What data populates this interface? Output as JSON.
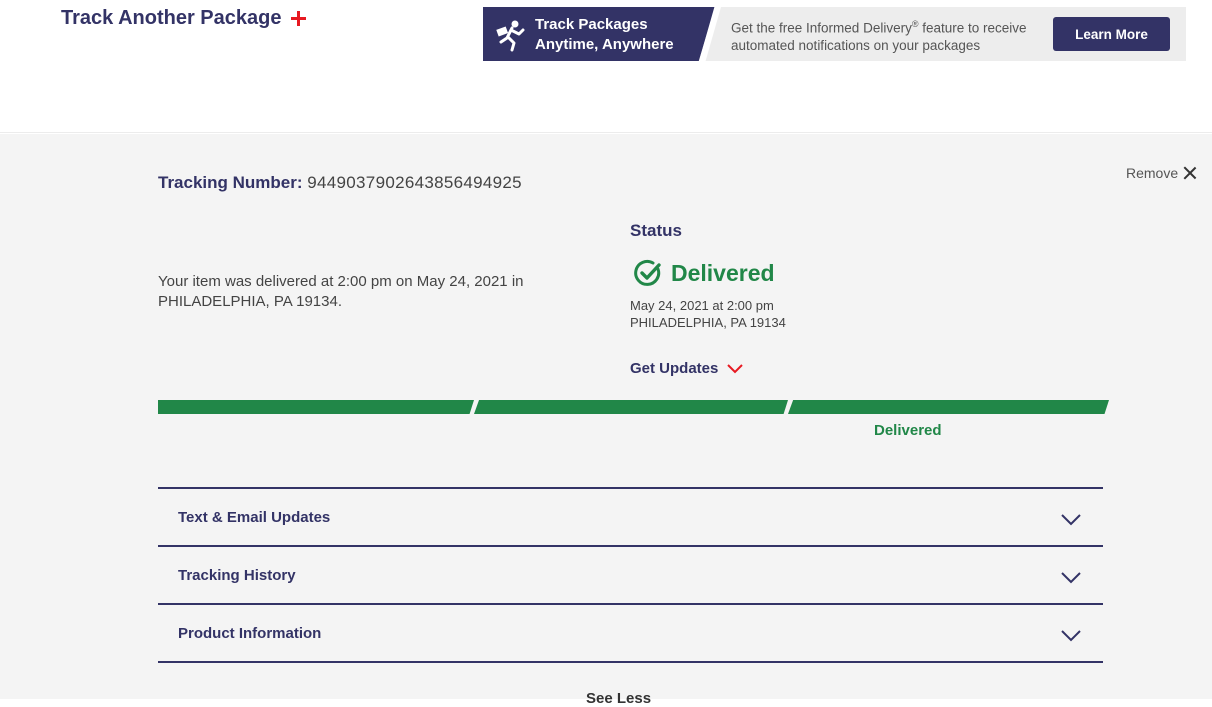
{
  "header": {
    "track_another_label": "Track Another Package"
  },
  "banner": {
    "title_line1": "Track Packages",
    "title_line2": "Anytime, Anywhere",
    "text_line1": "Get the free Informed Delivery",
    "text_reg": "®",
    "text_line1_end": " feature to receive",
    "text_line2": "automated notifications on your packages",
    "button_label": "Learn More"
  },
  "tracking": {
    "remove_label": "Remove",
    "number_label": "Tracking Number:",
    "number_value": "9449037902643856494925",
    "message": "Your item was delivered at 2:00 pm on May 24, 2021 in PHILADELPHIA, PA 19134.",
    "status_heading": "Status",
    "status_value": "Delivered",
    "status_date": "May 24, 2021 at 2:00 pm",
    "status_location": "PHILADELPHIA, PA 19134",
    "get_updates_label": "Get Updates",
    "progress_end_label": "Delivered",
    "progress_fraction": 1.0
  },
  "accordions": [
    {
      "label": "Text & Email Updates"
    },
    {
      "label": "Tracking History"
    },
    {
      "label": "Product Information"
    }
  ],
  "see_less_label": "See Less",
  "colors": {
    "brand_navy": "#333366",
    "accent_red": "#e71921",
    "status_green": "#218748",
    "panel_bg": "#f4f4f4"
  }
}
